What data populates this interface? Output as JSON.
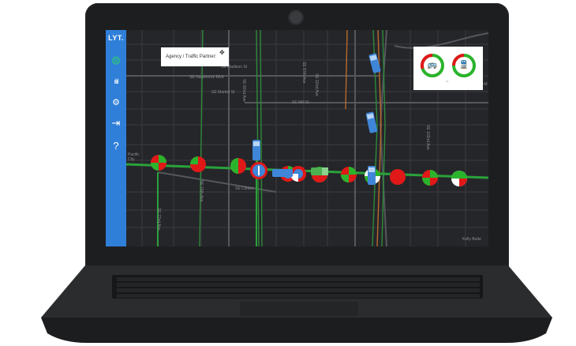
{
  "sidebar": {
    "logo": "LYT.",
    "items": [
      {
        "icon": "globe-icon",
        "glyph": "◍"
      },
      {
        "icon": "bar-chart-icon",
        "glyph": "ılıl"
      },
      {
        "icon": "user-settings-icon",
        "glyph": "⚙"
      },
      {
        "icon": "logout-icon",
        "glyph": "⇥"
      },
      {
        "icon": "help-icon",
        "glyph": "?"
      }
    ]
  },
  "agency_panel": {
    "label": "Agency / Traffic Partner:",
    "drag_icon": "✥"
  },
  "map": {
    "road_labels": [
      "SE Madison St",
      "SE Hawthorne Blvd",
      "SE Market St",
      "SE Mill St",
      "SE Clinton",
      "SE 82nd Ave",
      "SE 76th Ave",
      "SE 72nd Ave",
      "SE 87th Ave",
      "SE 92nd Ave",
      "SE 102nd Ave",
      "SE-M",
      "Kelly Butte",
      "Pacific City"
    ],
    "colors": {
      "green": "#2bb32b",
      "red": "#e01818",
      "bus_blue": "#3f86d8"
    }
  },
  "legend": {
    "items": [
      {
        "icon": "bus-icon",
        "glyph": "🚌"
      },
      {
        "icon": "train-icon",
        "glyph": "🚆"
      }
    ],
    "footnote": "~"
  }
}
